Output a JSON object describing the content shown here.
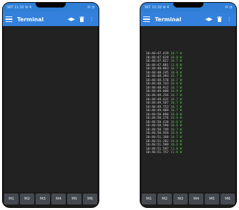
{
  "status_time": "SKT 11:32",
  "status_icons_left": "⚙ 4",
  "status_icons_right": "✉ ◔",
  "app_title": "Terminal",
  "icons": {
    "menu": "hamburger-menu-icon",
    "connect": "arrows-icon",
    "delete": "trash-icon",
    "more": "more-vert-icon"
  },
  "macro_keys": [
    "M1",
    "M2",
    "M3",
    "M4",
    "M5",
    "M6"
  ],
  "terminal_lines": [
    {
      "time": "10:48:47.419",
      "value": "10.7 W"
    },
    {
      "time": "10:48:47.629",
      "value": "10.8 W"
    },
    {
      "time": "10:48:47.827",
      "value": "10.7 W"
    },
    {
      "time": "10:48:47.881",
      "value": "11.0 W"
    },
    {
      "time": "10:48:48.063",
      "value": "10.7 W"
    },
    {
      "time": "10:48:48.245",
      "value": "10.8 W"
    },
    {
      "time": "10:48:48.394",
      "value": "10.7 W"
    },
    {
      "time": "10:48:48.570",
      "value": "10.7 W"
    },
    {
      "time": "10:48:48.743",
      "value": "10.6 W"
    },
    {
      "time": "10:48:48.912",
      "value": "10.7 W"
    },
    {
      "time": "10:48:49.080",
      "value": "10.8 W"
    },
    {
      "time": "10:48:49.256",
      "value": "10.7 W"
    },
    {
      "time": "10:48:49.431",
      "value": "10.7 W"
    },
    {
      "time": "10:48:49.587",
      "value": "10.7 W"
    },
    {
      "time": "10:48:49.753",
      "value": "10.7 W"
    },
    {
      "time": "10:48:49.909",
      "value": "10.7 W"
    },
    {
      "time": "10:48:50.090",
      "value": "10.6 W"
    },
    {
      "time": "10:48:50.276",
      "value": "10.6 W"
    },
    {
      "time": "10:48:50.420",
      "value": "10.6 W"
    },
    {
      "time": "10:48:50.590",
      "value": "10.6 W"
    },
    {
      "time": "10:48:50.749",
      "value": "10.7 W"
    },
    {
      "time": "10:48:50.939",
      "value": "10.6 W"
    },
    {
      "time": "10:48:51.168",
      "value": "10.7 W"
    },
    {
      "time": "10:48:51.282",
      "value": "10.8 W"
    },
    {
      "time": "10:48:51.509",
      "value": "10.6 W"
    },
    {
      "time": "10:48:51.597",
      "value": "11.0 W"
    },
    {
      "time": "10:48:51.757",
      "value": "11.0 W"
    }
  ],
  "colors": {
    "appbar": "#3381dc",
    "statusbar": "#2f7fd6",
    "terminal_bg": "#222222",
    "terminal_value": "#52d04b",
    "key_bg": "#454a50"
  }
}
